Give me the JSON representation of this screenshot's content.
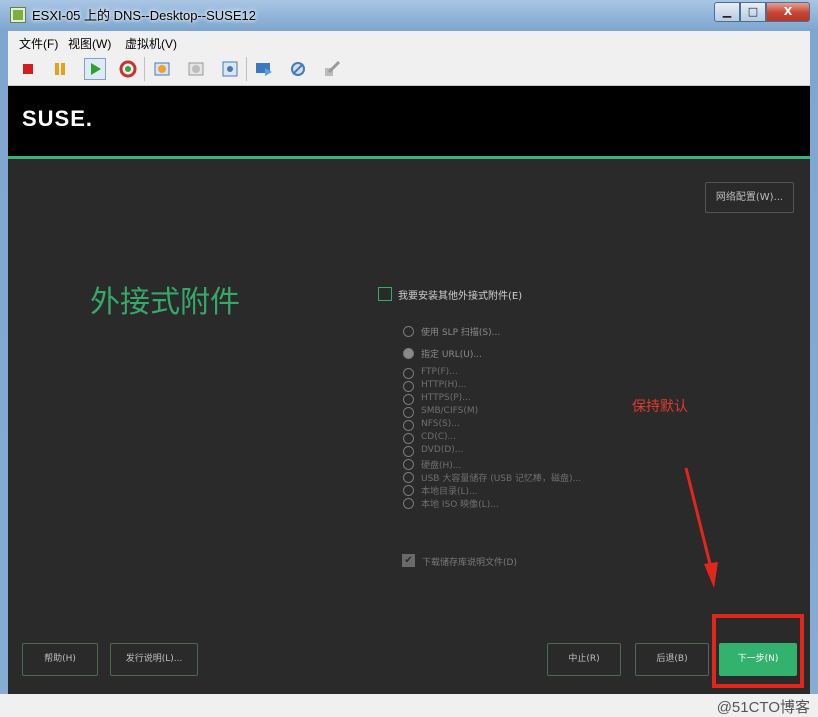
{
  "window": {
    "title": "ESXI-05 上的 DNS--Desktop--SUSE12",
    "min_label": "▁",
    "max_label": "□",
    "close_label": "X"
  },
  "menu": [
    "文件(F)",
    "视图(W)",
    "虚拟机(V)"
  ],
  "toolbar_icons": [
    "stop-icon",
    "pause-icon",
    "play-icon",
    "reset-icon",
    "snapshot-icon",
    "revert-snapshot-icon",
    "snapshot-manager-icon",
    "console-icon",
    "settings-icon",
    "edit-settings-icon"
  ],
  "installer": {
    "logo": "SUSE.",
    "network_button": "网络配置(W)...",
    "page_title": "外接式附件",
    "main_checkbox_label": "我要安装其他外接式附件(E)",
    "options": [
      "使用 SLP 扫描(S)...",
      "指定 URL(U)...",
      "FTP(F)...",
      "HTTP(H)...",
      "HTTPS(P)...",
      "SMB/CIFS(M)",
      "NFS(S)...",
      "CD(C)...",
      "DVD(D)...",
      "硬盘(H)...",
      "USB 大容量储存 (USB 记忆棒，磁盘)...",
      "本地目录(L)...",
      "本地 ISO 映像(L)..."
    ],
    "selected_option_index": 1,
    "docs_checkbox_label": "下载储存库说明文件(D)",
    "docs_checked": true,
    "buttons": {
      "help": "帮助(H)",
      "release_notes": "发行说明(L)...",
      "abort": "中止(R)",
      "back": "后退(B)",
      "next": "下一步(N)"
    }
  },
  "annotation_text": "保持默认",
  "watermark": "@51CTO博客",
  "colors": {
    "accent": "#35a86a",
    "annotation": "#e1261c"
  }
}
